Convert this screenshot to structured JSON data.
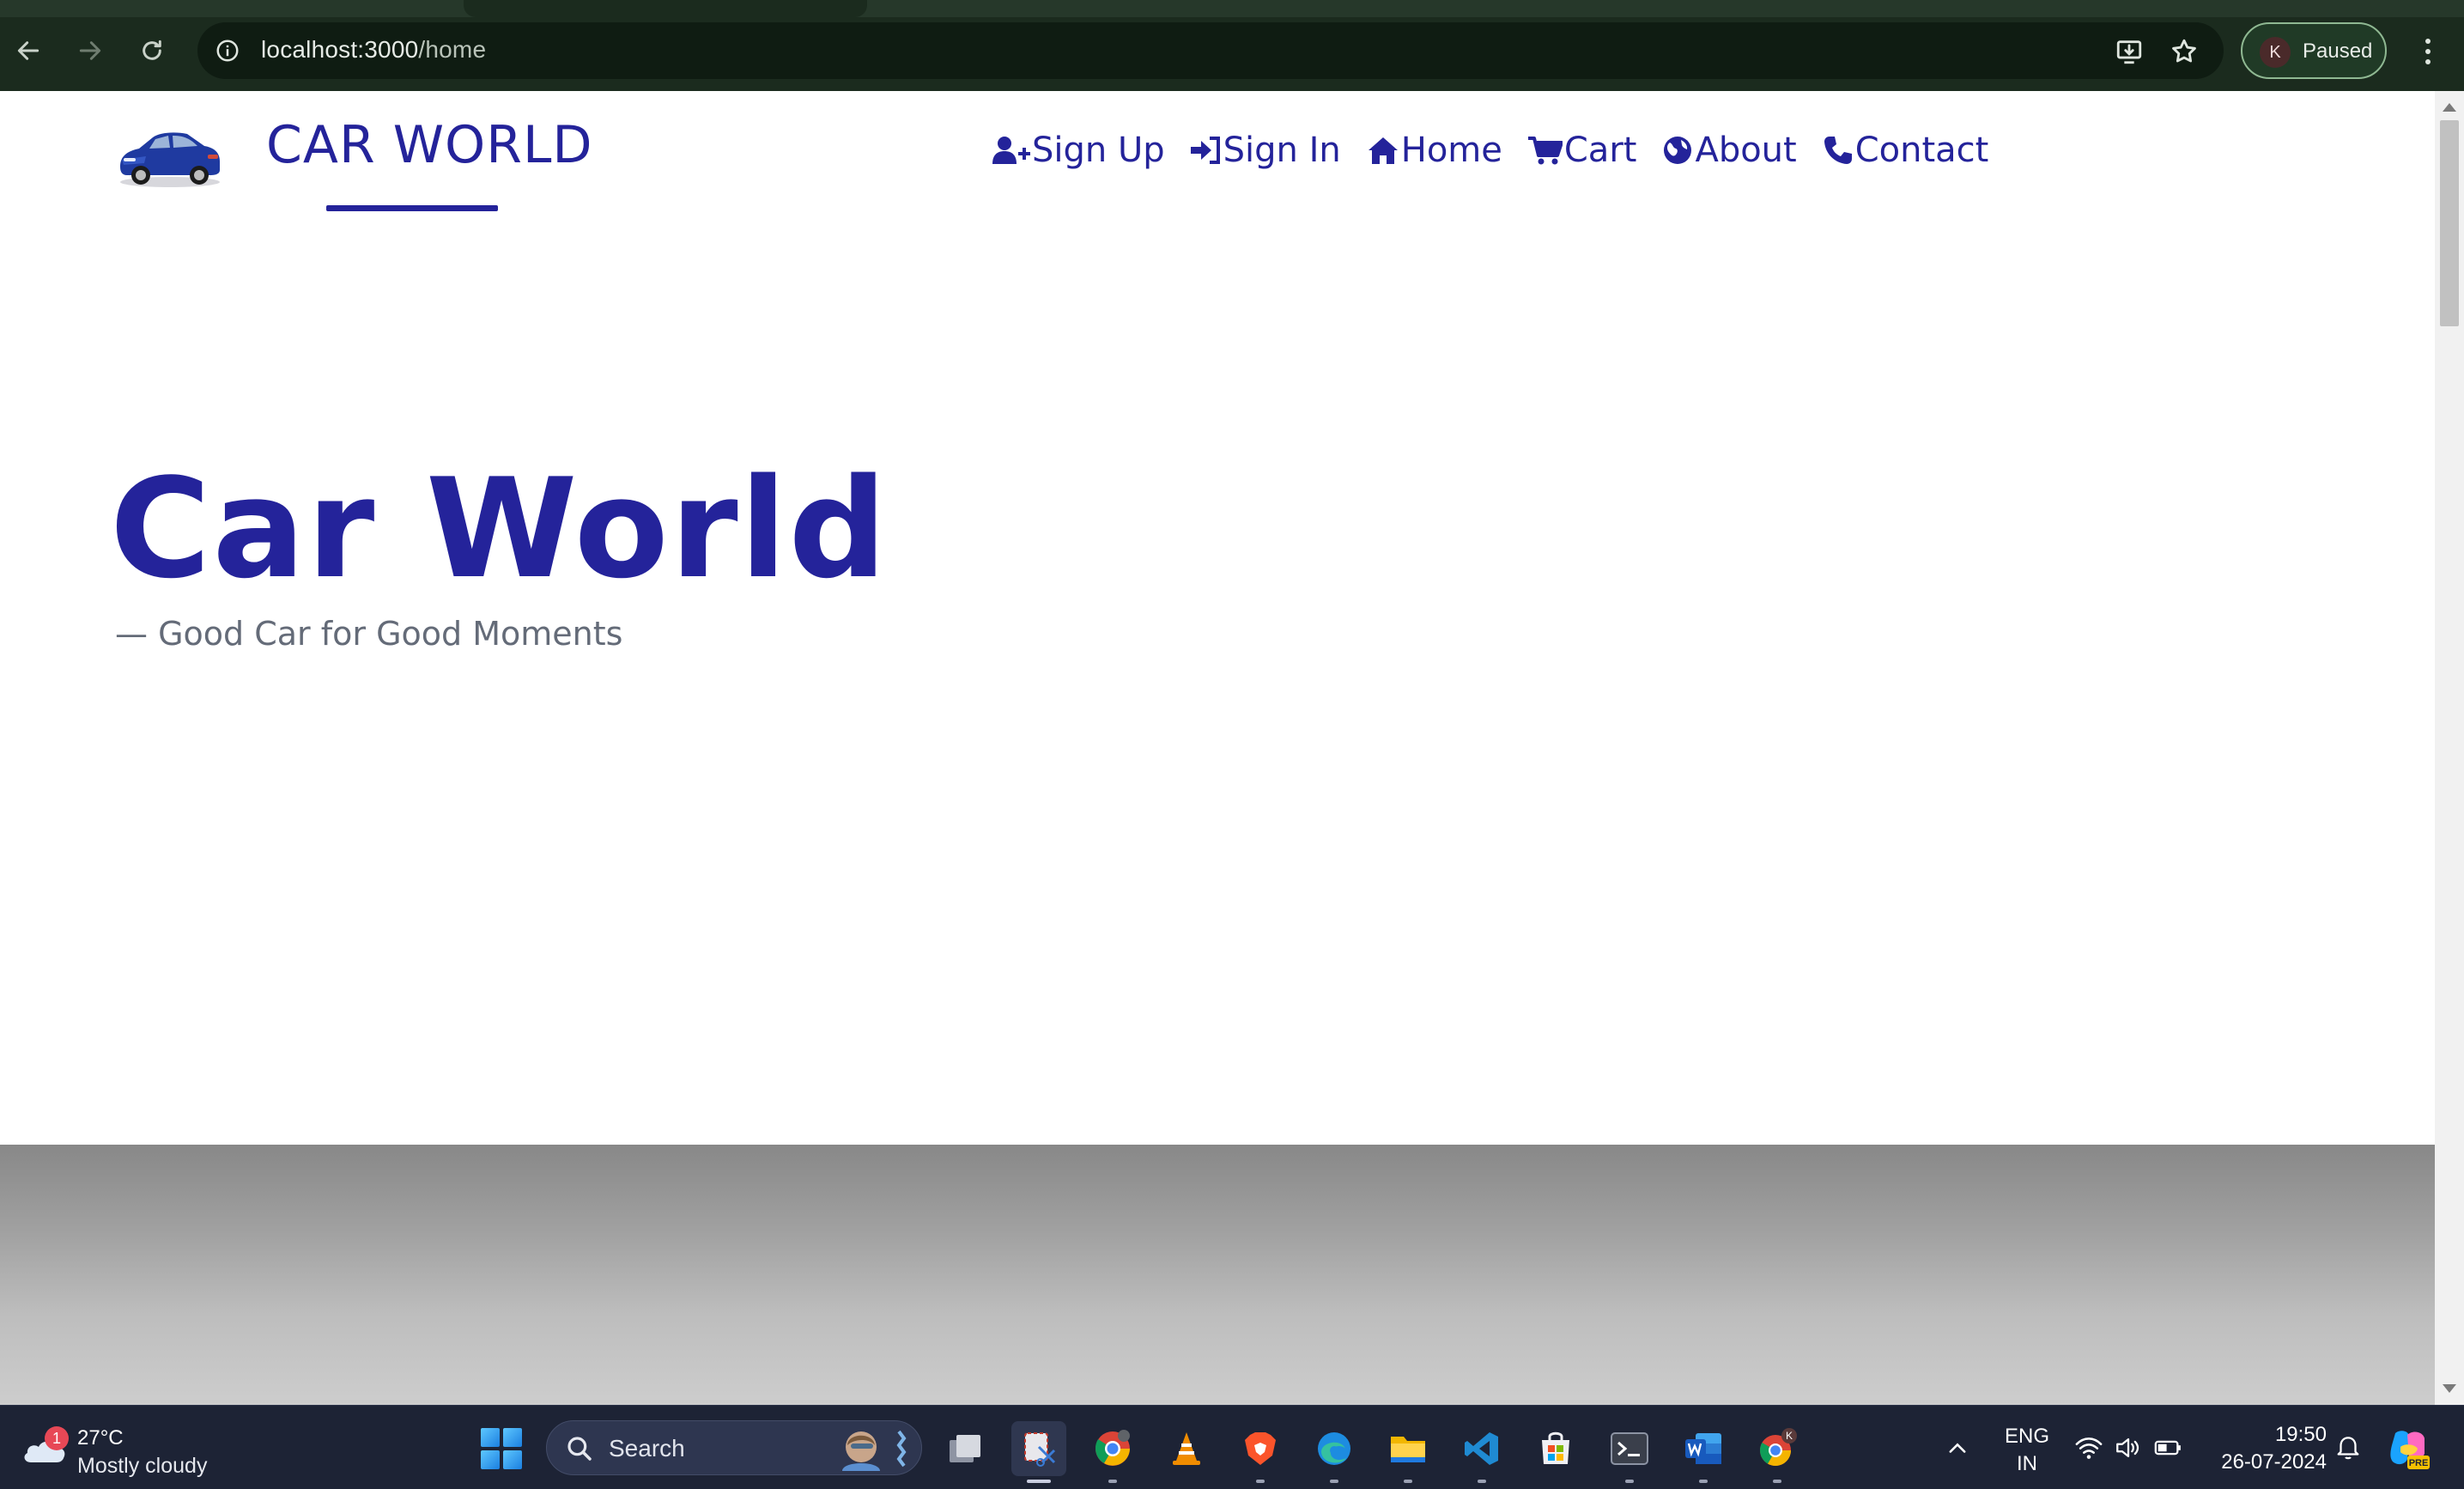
{
  "browser": {
    "url_host": "localhost:3000",
    "url_path": "/home",
    "profile_initial": "K",
    "profile_status": "Paused"
  },
  "site": {
    "brand": "CAR WORLD",
    "nav": [
      {
        "label": "Sign Up",
        "icon": "user-plus-icon"
      },
      {
        "label": "Sign In",
        "icon": "sign-in-icon"
      },
      {
        "label": "Home",
        "icon": "home-icon"
      },
      {
        "label": "Cart",
        "icon": "cart-icon"
      },
      {
        "label": "About",
        "icon": "globe-icon"
      },
      {
        "label": "Contact",
        "icon": "phone-icon"
      }
    ],
    "hero_title": "Car World",
    "hero_subtitle": "— Good Car for Good Moments",
    "accent": "#24239a"
  },
  "taskbar": {
    "weather_badge": "1",
    "weather_temp": "27°C",
    "weather_condition": "Mostly cloudy",
    "search_label": "Search",
    "lang_line1": "ENG",
    "lang_line2": "IN",
    "time": "19:50",
    "date": "26-07-2024",
    "chrome_profile_badge": "K",
    "copilot_badge": "PRE"
  }
}
